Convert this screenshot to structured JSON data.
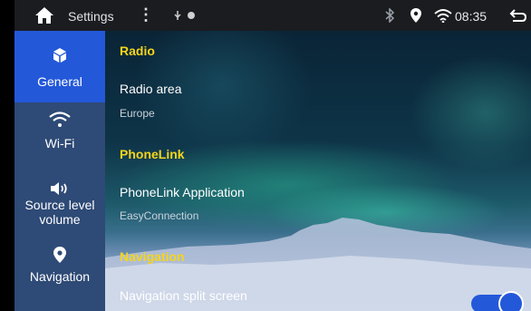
{
  "statusbar": {
    "title": "Settings",
    "time": "08:35"
  },
  "sidebar": {
    "items": [
      {
        "label": "General",
        "icon": "cube-icon",
        "active": true
      },
      {
        "label": "Wi-Fi",
        "icon": "wifi-icon",
        "active": false
      },
      {
        "label_line1": "Source level",
        "label_line2": "volume",
        "icon": "speaker-icon",
        "active": false
      },
      {
        "label": "Navigation",
        "icon": "location-pin-icon",
        "active": false
      }
    ]
  },
  "content": {
    "sections": [
      {
        "title": "Radio",
        "items": [
          {
            "title": "Radio area",
            "value": "Europe"
          }
        ]
      },
      {
        "title": "PhoneLink",
        "items": [
          {
            "title": "PhoneLink Application",
            "value": "EasyConnection"
          }
        ]
      },
      {
        "title": "Navigation",
        "items": [
          {
            "title": "Navigation split screen",
            "toggle": true
          }
        ]
      }
    ]
  },
  "colors": {
    "accent": "#2358d9",
    "sidebar": "#2e4a76",
    "section_header": "#f5d51b",
    "statusbar": "#1a1c20"
  }
}
